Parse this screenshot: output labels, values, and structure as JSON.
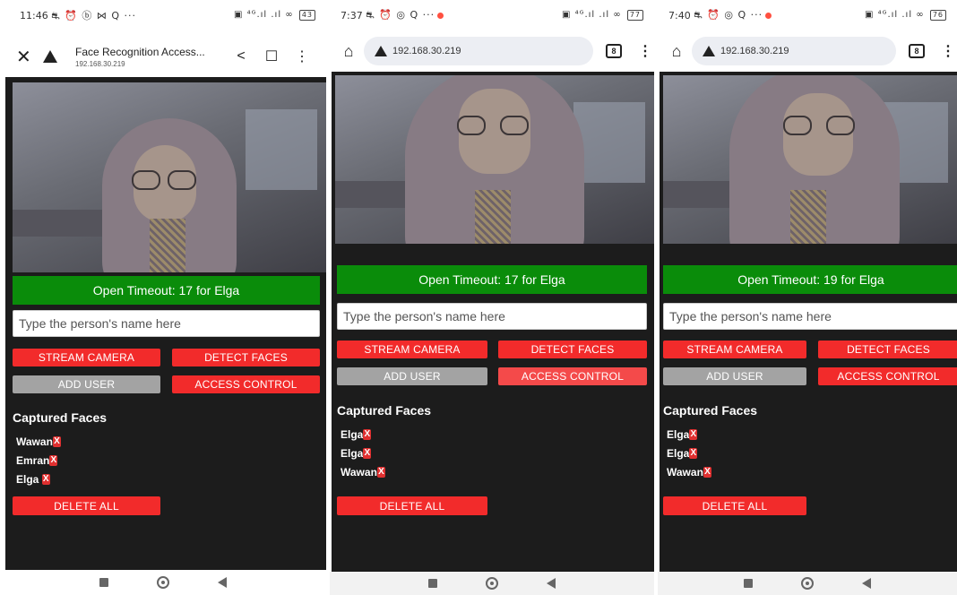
{
  "phones": [
    {
      "status": {
        "time": "11:46",
        "icons": "⛐ ⏰ ⓑ ⋈ Q ···",
        "right": "▣ ⁴ᴳ.ıl .ıl ∞",
        "battery": "43"
      },
      "toolbar": {
        "title": "Face Recognition Access...",
        "url": "192.168.30.219",
        "tab_count": ""
      },
      "banner": "Open Timeout: 17 for Elga",
      "faces": [
        {
          "name": "Wawan",
          "remove": "X"
        },
        {
          "name": "Emran",
          "remove": "X"
        },
        {
          "name": "Elga ",
          "remove": "X"
        }
      ]
    },
    {
      "status": {
        "time": "7:37",
        "icons": "⛐ ⏰ ◎ Q ···",
        "right": "▣ ⁴ᴳ.ıl .ıl ∞",
        "battery": "77"
      },
      "toolbar": {
        "title": "",
        "url": "192.168.30.219",
        "tab_count": "8"
      },
      "banner": "Open Timeout: 17 for Elga",
      "faces": [
        {
          "name": "Elga",
          "remove": "X"
        },
        {
          "name": "Elga",
          "remove": "X"
        },
        {
          "name": "Wawan",
          "remove": "X"
        }
      ]
    },
    {
      "status": {
        "time": "7:40",
        "icons": "⛐ ⏰ ◎ Q ···",
        "right": "▣ ⁴ᴳ.ıl .ıl ∞",
        "battery": "76"
      },
      "toolbar": {
        "title": "",
        "url": "192.168.30.219",
        "tab_count": "8"
      },
      "banner": "Open Timeout: 19 for Elga",
      "faces": [
        {
          "name": "Elga",
          "remove": "X"
        },
        {
          "name": "Elga",
          "remove": "X"
        },
        {
          "name": "Wawan",
          "remove": "X"
        }
      ]
    }
  ],
  "form": {
    "placeholder": "Type the person's name here"
  },
  "buttons": {
    "stream": "STREAM CAMERA",
    "detect": "DETECT FACES",
    "add_user": "ADD USER",
    "access": "ACCESS CONTROL",
    "delete_all": "DELETE ALL"
  },
  "faces_heading": "Captured Faces",
  "icons": {
    "close": "close-icon",
    "warning": "warning-icon",
    "share": "share-icon",
    "bookmark": "bookmark-icon",
    "menu": "more-vert-icon",
    "home": "home-icon",
    "tabs": "tabs-icon",
    "remove": "remove-face-icon",
    "nav_recent": "recent-apps-icon",
    "nav_home": "home-nav-icon",
    "nav_back": "back-icon"
  },
  "colors": {
    "banner": "#0a8c0a",
    "button_red": "#f22b2b",
    "button_gray": "#a3a3a3",
    "button_salmon": "#f44a4a",
    "page_bg": "#1c1c1c",
    "remove_x": "#e03030"
  }
}
